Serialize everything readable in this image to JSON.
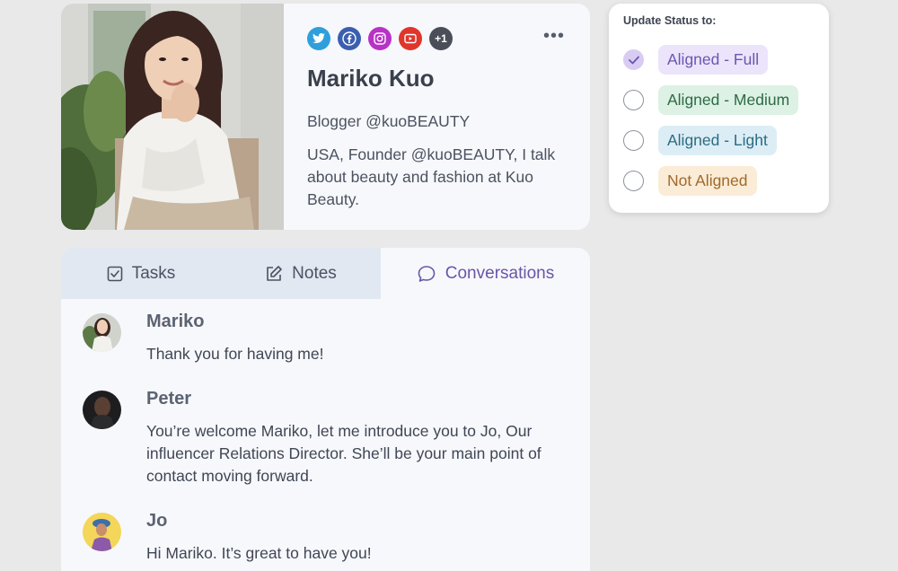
{
  "profile": {
    "name": "Mariko Kuo",
    "handle": "Blogger @kuoBEAUTY",
    "bio": "USA, Founder @kuoBEAUTY, I talk about beauty and fashion at Kuo Beauty.",
    "more_label": "•••",
    "social": [
      {
        "icon": "twitter-icon",
        "color": "#2f9fdc"
      },
      {
        "icon": "facebook-icon",
        "color": "#3b5fb0"
      },
      {
        "icon": "instagram-icon",
        "color": "#b832c6"
      },
      {
        "icon": "youtube-icon",
        "color": "#e0352b"
      }
    ],
    "extra_count": "+1"
  },
  "status": {
    "title": "Update Status to:",
    "options": [
      {
        "label": "Aligned - Full",
        "checked": true,
        "bg": "#ebe4fb",
        "fg": "#6b57b0"
      },
      {
        "label": "Aligned - Medium",
        "checked": false,
        "bg": "#ddf1e4",
        "fg": "#2d6b47"
      },
      {
        "label": "Aligned - Light",
        "checked": false,
        "bg": "#dcedf5",
        "fg": "#2b6c84"
      },
      {
        "label": "Not Aligned",
        "checked": false,
        "bg": "#fbecd7",
        "fg": "#a06a2b"
      }
    ]
  },
  "tabs": [
    {
      "label": "Tasks",
      "icon": "checkbox-icon",
      "active": false
    },
    {
      "label": "Notes",
      "icon": "edit-icon",
      "active": false
    },
    {
      "label": "Conversations",
      "icon": "chat-bubble-icon",
      "active": true
    }
  ],
  "messages": [
    {
      "name": "Mariko",
      "text": "Thank you for having me!"
    },
    {
      "name": "Peter",
      "text": "You’re welcome Mariko, let me introduce you to Jo, Our influencer Relations Director. She’ll be your main point of contact moving forward."
    },
    {
      "name": "Jo",
      "text": "Hi Mariko. It’s great to have you!"
    }
  ]
}
